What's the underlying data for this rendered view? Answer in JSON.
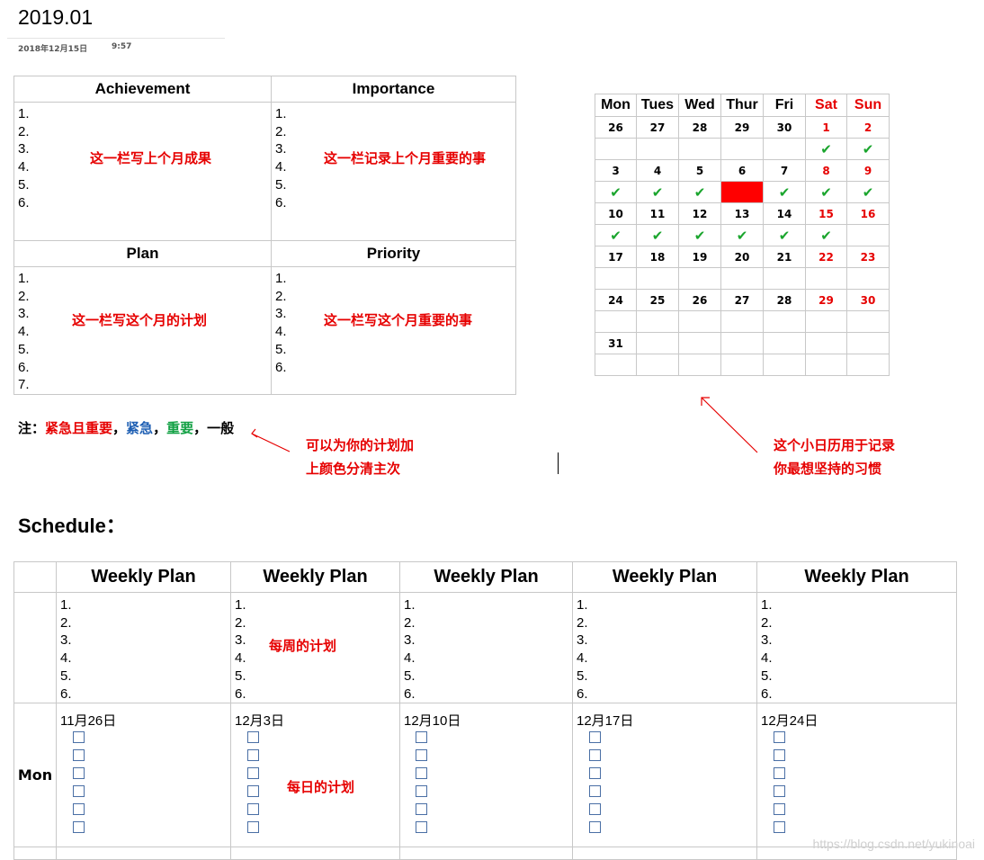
{
  "header": {
    "title": "2019.01",
    "date": "2018年12月15日",
    "time": "9:57"
  },
  "monthly": {
    "achievement": {
      "title": "Achievement",
      "items": [
        "1.",
        "2.",
        "3.",
        "4.",
        "5.",
        "6."
      ],
      "note": "这一栏写上个月成果"
    },
    "importance": {
      "title": "Importance",
      "items": [
        "1.",
        "2.",
        "3.",
        "4.",
        "5.",
        "6."
      ],
      "note": "这一栏记录上个月重要的事"
    },
    "plan": {
      "title": "Plan",
      "items": [
        "1.",
        "2.",
        "3.",
        "4.",
        "5.",
        "6.",
        "7."
      ],
      "note": "这一栏写这个月的计划"
    },
    "priority": {
      "title": "Priority",
      "items": [
        "1.",
        "2.",
        "3.",
        "4.",
        "5.",
        "6."
      ],
      "note": "这一栏写这个月重要的事"
    }
  },
  "legend": {
    "prefix": "注：",
    "red": "紧急且重要",
    "sep1": "，",
    "blue": "紧急",
    "sep2": "，",
    "green": "重要",
    "sep3": "，",
    "plain": "一般",
    "hint_line1": "可以为你的计划加",
    "hint_line2": "上颜色分清主次"
  },
  "calendar": {
    "days": [
      "Mon",
      "Tues",
      "Wed",
      "Thur",
      "Fri",
      "Sat",
      "Sun"
    ],
    "weeks": [
      {
        "dates": [
          "26",
          "27",
          "28",
          "29",
          "30",
          "1",
          "2"
        ],
        "checks": [
          "",
          "",
          "",
          "",
          "",
          "✔",
          "✔"
        ]
      },
      {
        "dates": [
          "3",
          "4",
          "5",
          "6",
          "7",
          "8",
          "9"
        ],
        "checks": [
          "✔",
          "✔",
          "✔",
          "",
          "✔",
          "✔",
          "✔"
        ]
      },
      {
        "dates": [
          "10",
          "11",
          "12",
          "13",
          "14",
          "15",
          "16"
        ],
        "checks": [
          "✔",
          "✔",
          "✔",
          "✔",
          "✔",
          "✔",
          ""
        ]
      },
      {
        "dates": [
          "17",
          "18",
          "19",
          "20",
          "21",
          "22",
          "23"
        ],
        "checks": [
          "",
          "",
          "",
          "",
          "",
          "",
          ""
        ]
      },
      {
        "dates": [
          "24",
          "25",
          "26",
          "27",
          "28",
          "29",
          "30"
        ],
        "checks": [
          "",
          "",
          "",
          "",
          "",
          "",
          ""
        ]
      },
      {
        "dates": [
          "31",
          "",
          "",
          "",
          "",
          "",
          ""
        ],
        "checks": [
          "",
          "",
          "",
          "",
          "",
          "",
          ""
        ]
      }
    ],
    "highlight": {
      "week": 1,
      "day": 3,
      "color": "#ff0000"
    },
    "hint_line1": "这个小日历用于记录",
    "hint_line2": "你最想坚持的习惯"
  },
  "schedule": {
    "title": "Schedule：",
    "weeks": [
      {
        "header": "Weekly Plan",
        "items": [
          "1.",
          "2.",
          "3.",
          "4.",
          "5.",
          "6."
        ],
        "mon_date": "11月26日",
        "boxes": 6
      },
      {
        "header": "Weekly Plan",
        "items": [
          "1.",
          "2.",
          "3.",
          "4.",
          "5.",
          "6."
        ],
        "mon_date": "12月3日",
        "boxes": 6
      },
      {
        "header": "Weekly Plan",
        "items": [
          "1.",
          "2.",
          "3.",
          "4.",
          "5.",
          "6."
        ],
        "mon_date": "12月10日",
        "boxes": 6
      },
      {
        "header": "Weekly Plan",
        "items": [
          "1.",
          "2.",
          "3.",
          "4.",
          "5.",
          "6."
        ],
        "mon_date": "12月17日",
        "boxes": 6
      },
      {
        "header": "Weekly Plan",
        "items": [
          "1.",
          "2.",
          "3.",
          "4.",
          "5.",
          "6."
        ],
        "mon_date": "12月24日",
        "boxes": 6
      }
    ],
    "weekly_note": "每周的计划",
    "daily_note": "每日的计划",
    "day_label": "Mon"
  },
  "watermark": "https://blog.csdn.net/yukinoai",
  "colors": {
    "red": "#e60000",
    "blue": "#1e5fb3",
    "green": "#11a043",
    "check": "#1aa52d",
    "border": "#c8c8c8"
  }
}
